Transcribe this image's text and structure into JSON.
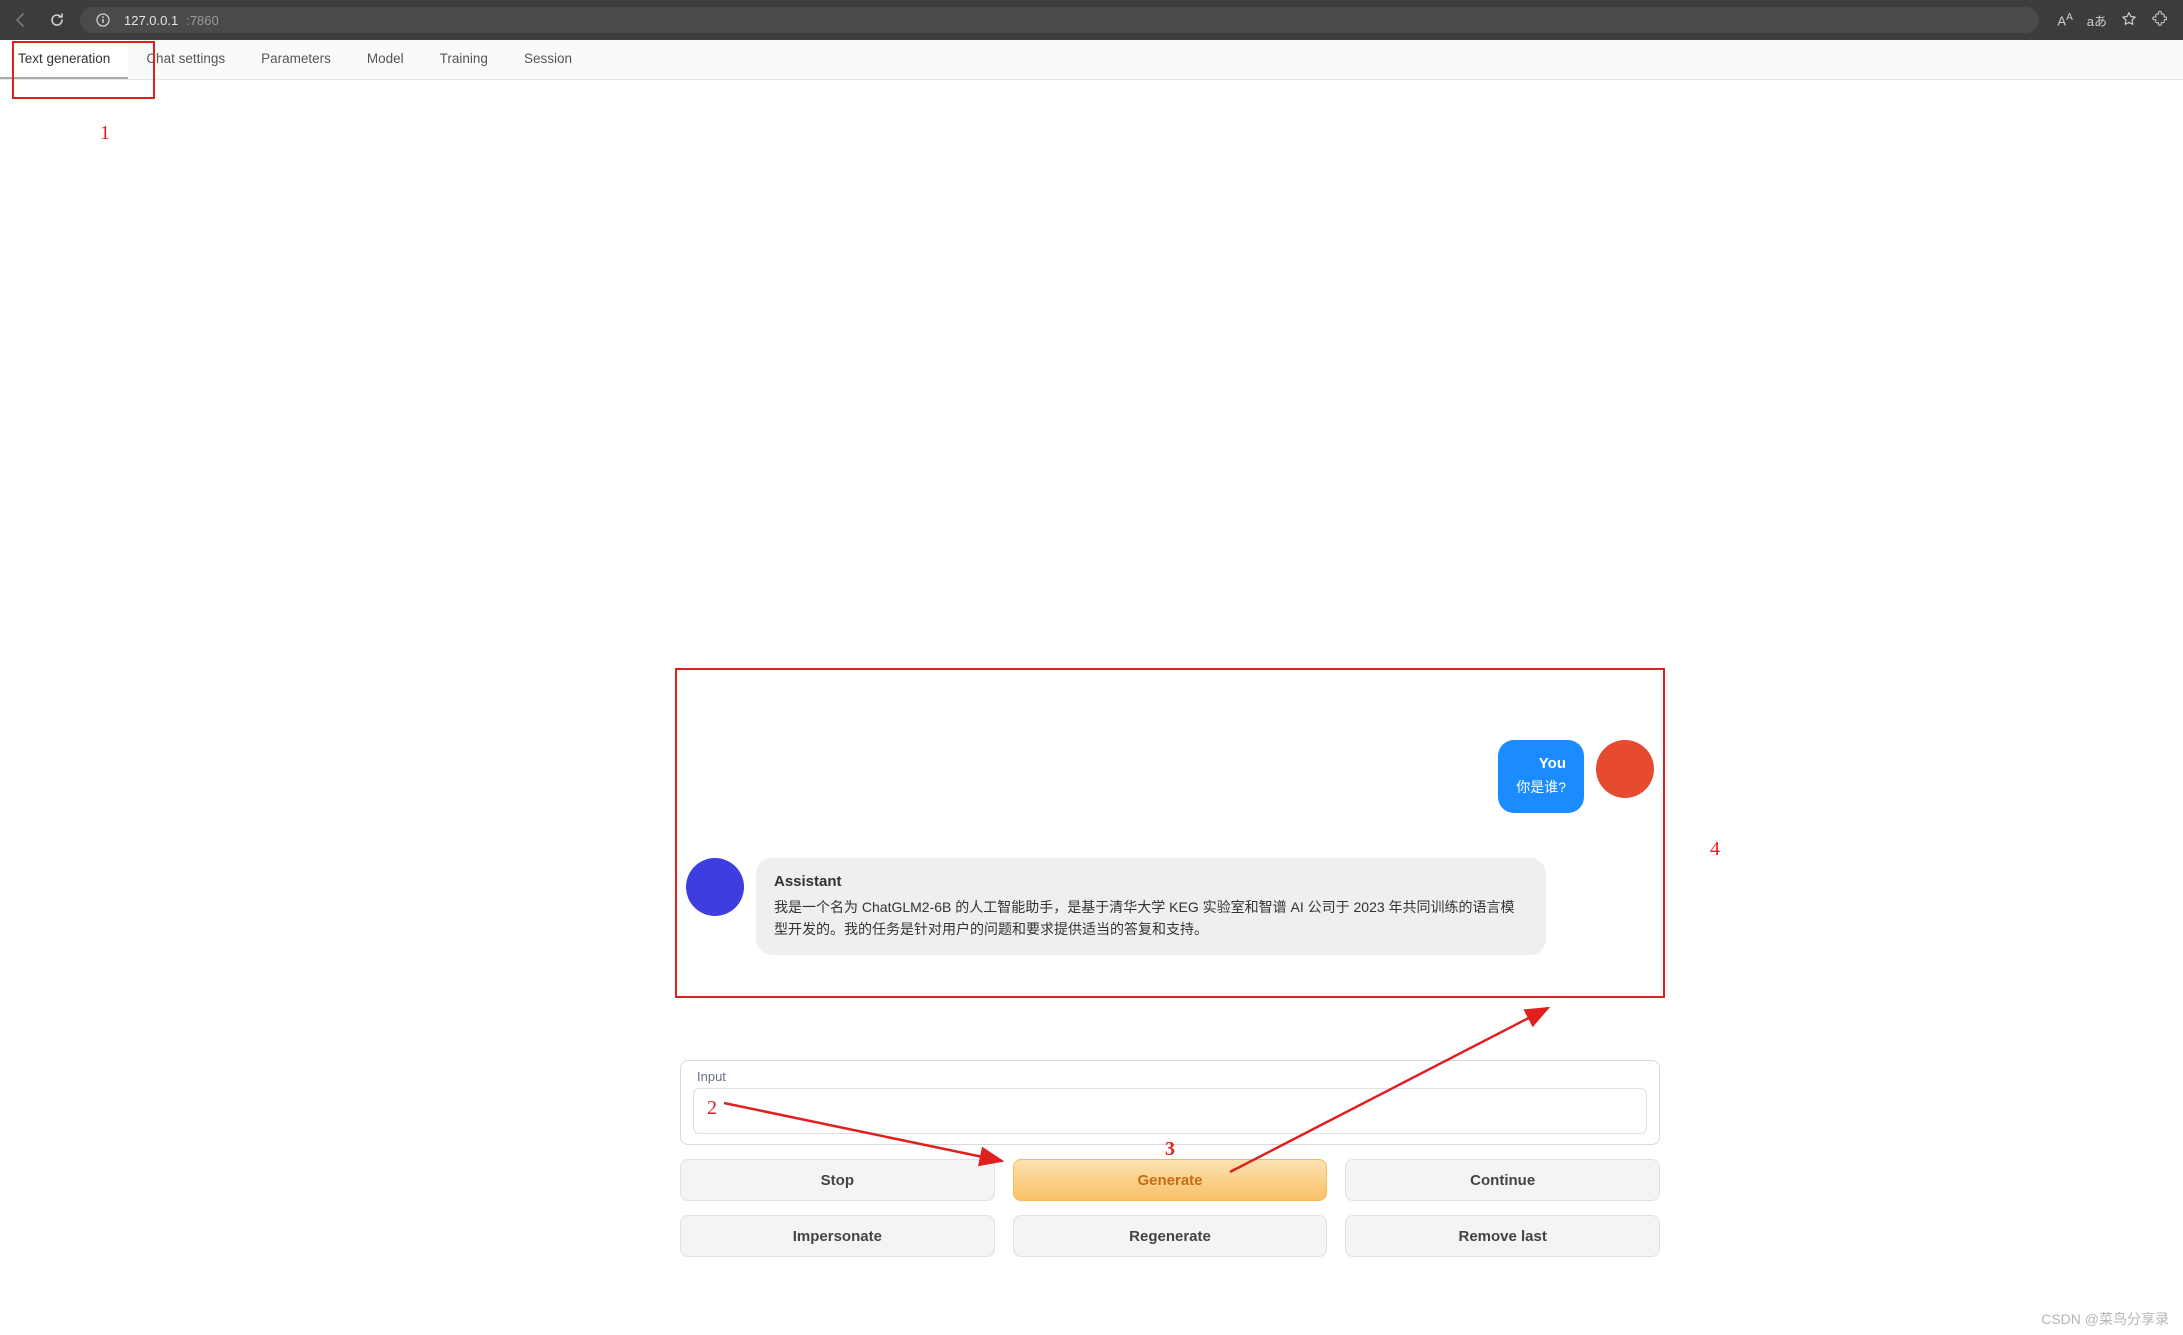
{
  "browser": {
    "url_host": "127.0.0.1",
    "url_port": ":7860",
    "right_items": [
      "A",
      "aあ"
    ]
  },
  "tabs": {
    "items": [
      {
        "label": "Text generation",
        "active": true
      },
      {
        "label": "Chat settings",
        "active": false
      },
      {
        "label": "Parameters",
        "active": false
      },
      {
        "label": "Model",
        "active": false
      },
      {
        "label": "Training",
        "active": false
      },
      {
        "label": "Session",
        "active": false
      }
    ]
  },
  "annotations": {
    "n1": "1",
    "n2": "2",
    "n3": "3",
    "n4": "4"
  },
  "chat": {
    "you_name": "You",
    "you_text": "你是谁?",
    "ai_name": "Assistant",
    "ai_text": "我是一个名为 ChatGLM2-6B 的人工智能助手，是基于清华大学 KEG 实验室和智谱 AI 公司于 2023 年共同训练的语言模型开发的。我的任务是针对用户的问题和要求提供适当的答复和支持。"
  },
  "input": {
    "label": "Input",
    "value": ""
  },
  "buttons": {
    "stop": "Stop",
    "generate": "Generate",
    "continue": "Continue",
    "impersonate": "Impersonate",
    "regenerate": "Regenerate",
    "remove_last": "Remove last"
  },
  "watermark": "CSDN @菜鸟分享录"
}
